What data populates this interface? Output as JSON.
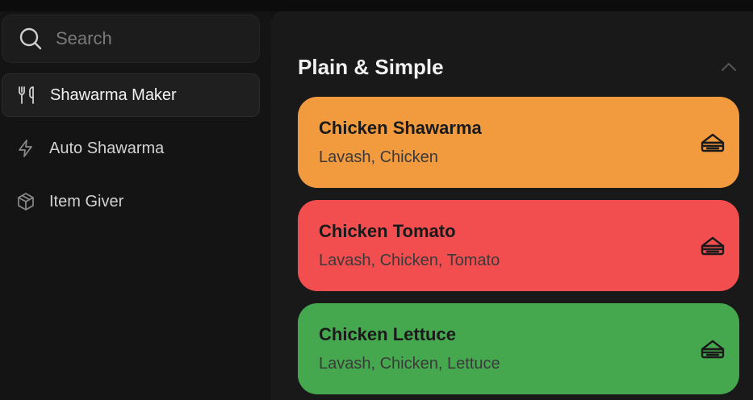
{
  "search": {
    "placeholder": "Search",
    "value": ""
  },
  "sidebar": {
    "items": [
      {
        "label": "Shawarma Maker",
        "icon": "utensils-icon",
        "active": true
      },
      {
        "label": "Auto Shawarma",
        "icon": "lightning-icon",
        "active": false
      },
      {
        "label": "Item Giver",
        "icon": "box-icon",
        "active": false
      }
    ]
  },
  "main": {
    "section_title": "Plain & Simple",
    "cards": [
      {
        "name": "Chicken Shawarma",
        "ingredients": "Lavash, Chicken",
        "color": "#f29a3e",
        "icon": "sandwich-icon"
      },
      {
        "name": "Chicken Tomato",
        "ingredients": "Lavash, Chicken, Tomato",
        "color": "#f24e50",
        "icon": "sandwich-icon"
      },
      {
        "name": "Chicken Lettuce",
        "ingredients": "Lavash, Chicken, Lettuce",
        "color": "#46a84e",
        "icon": "sandwich-icon"
      }
    ]
  },
  "colors": {
    "background": "#121212",
    "sidebar": "#141414",
    "panel": "#191919",
    "text_primary": "#f2f2f2",
    "text_muted": "#7a7a7a"
  }
}
